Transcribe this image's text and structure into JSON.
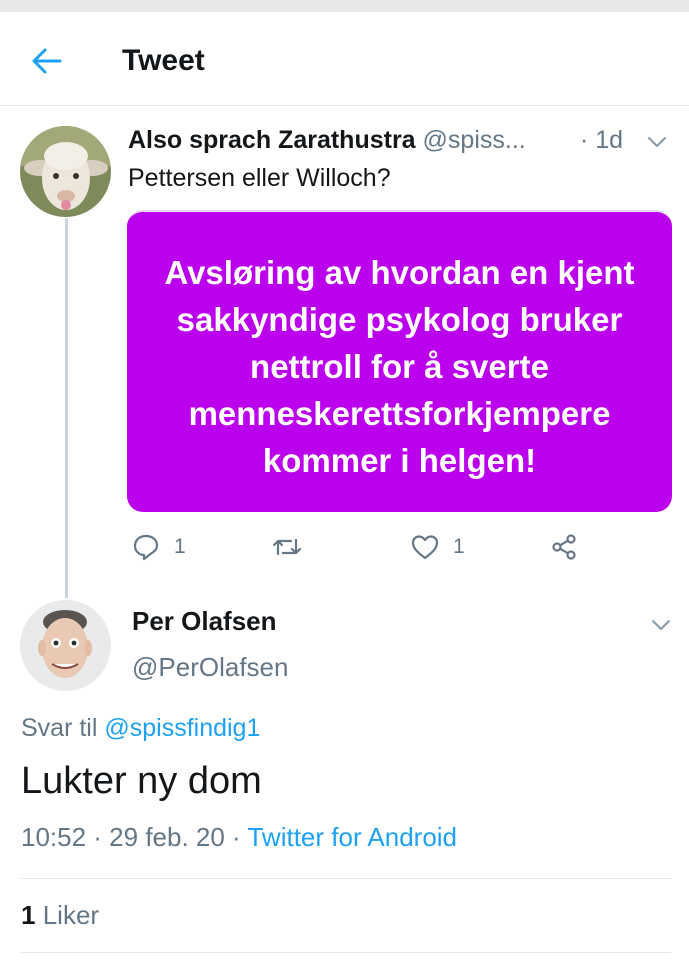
{
  "header": {
    "title": "Tweet",
    "back_icon": "arrow-left-icon"
  },
  "quoted_tweet": {
    "display_name": "Also sprach Zarathustra",
    "handle": "@spiss...",
    "time": "· 1d",
    "text": "Pettersen eller Willoch?",
    "card_text": "Avsløring av hvordan en kjent sakkyndige psykolog bruker nettroll for å sverte menneskerettsforkjempere kommer i helgen!",
    "card_color": "#bb00ee",
    "actions": {
      "reply_count": "1",
      "retweet_count": "",
      "like_count": "1"
    }
  },
  "reply_tweet": {
    "display_name": "Per Olafsen",
    "handle": "@PerOlafsen",
    "reply_prefix": "Svar til",
    "reply_to": "@spissfindig1",
    "text": "Lukter ny dom",
    "timestamp": "10:52 · 29 feb. 20 ·",
    "source": "Twitter for Android",
    "like_count": "1",
    "like_label": "Liker"
  },
  "colors": {
    "accent": "#1da1f2",
    "secondary_text": "#657786",
    "primary_text": "#14171a"
  }
}
